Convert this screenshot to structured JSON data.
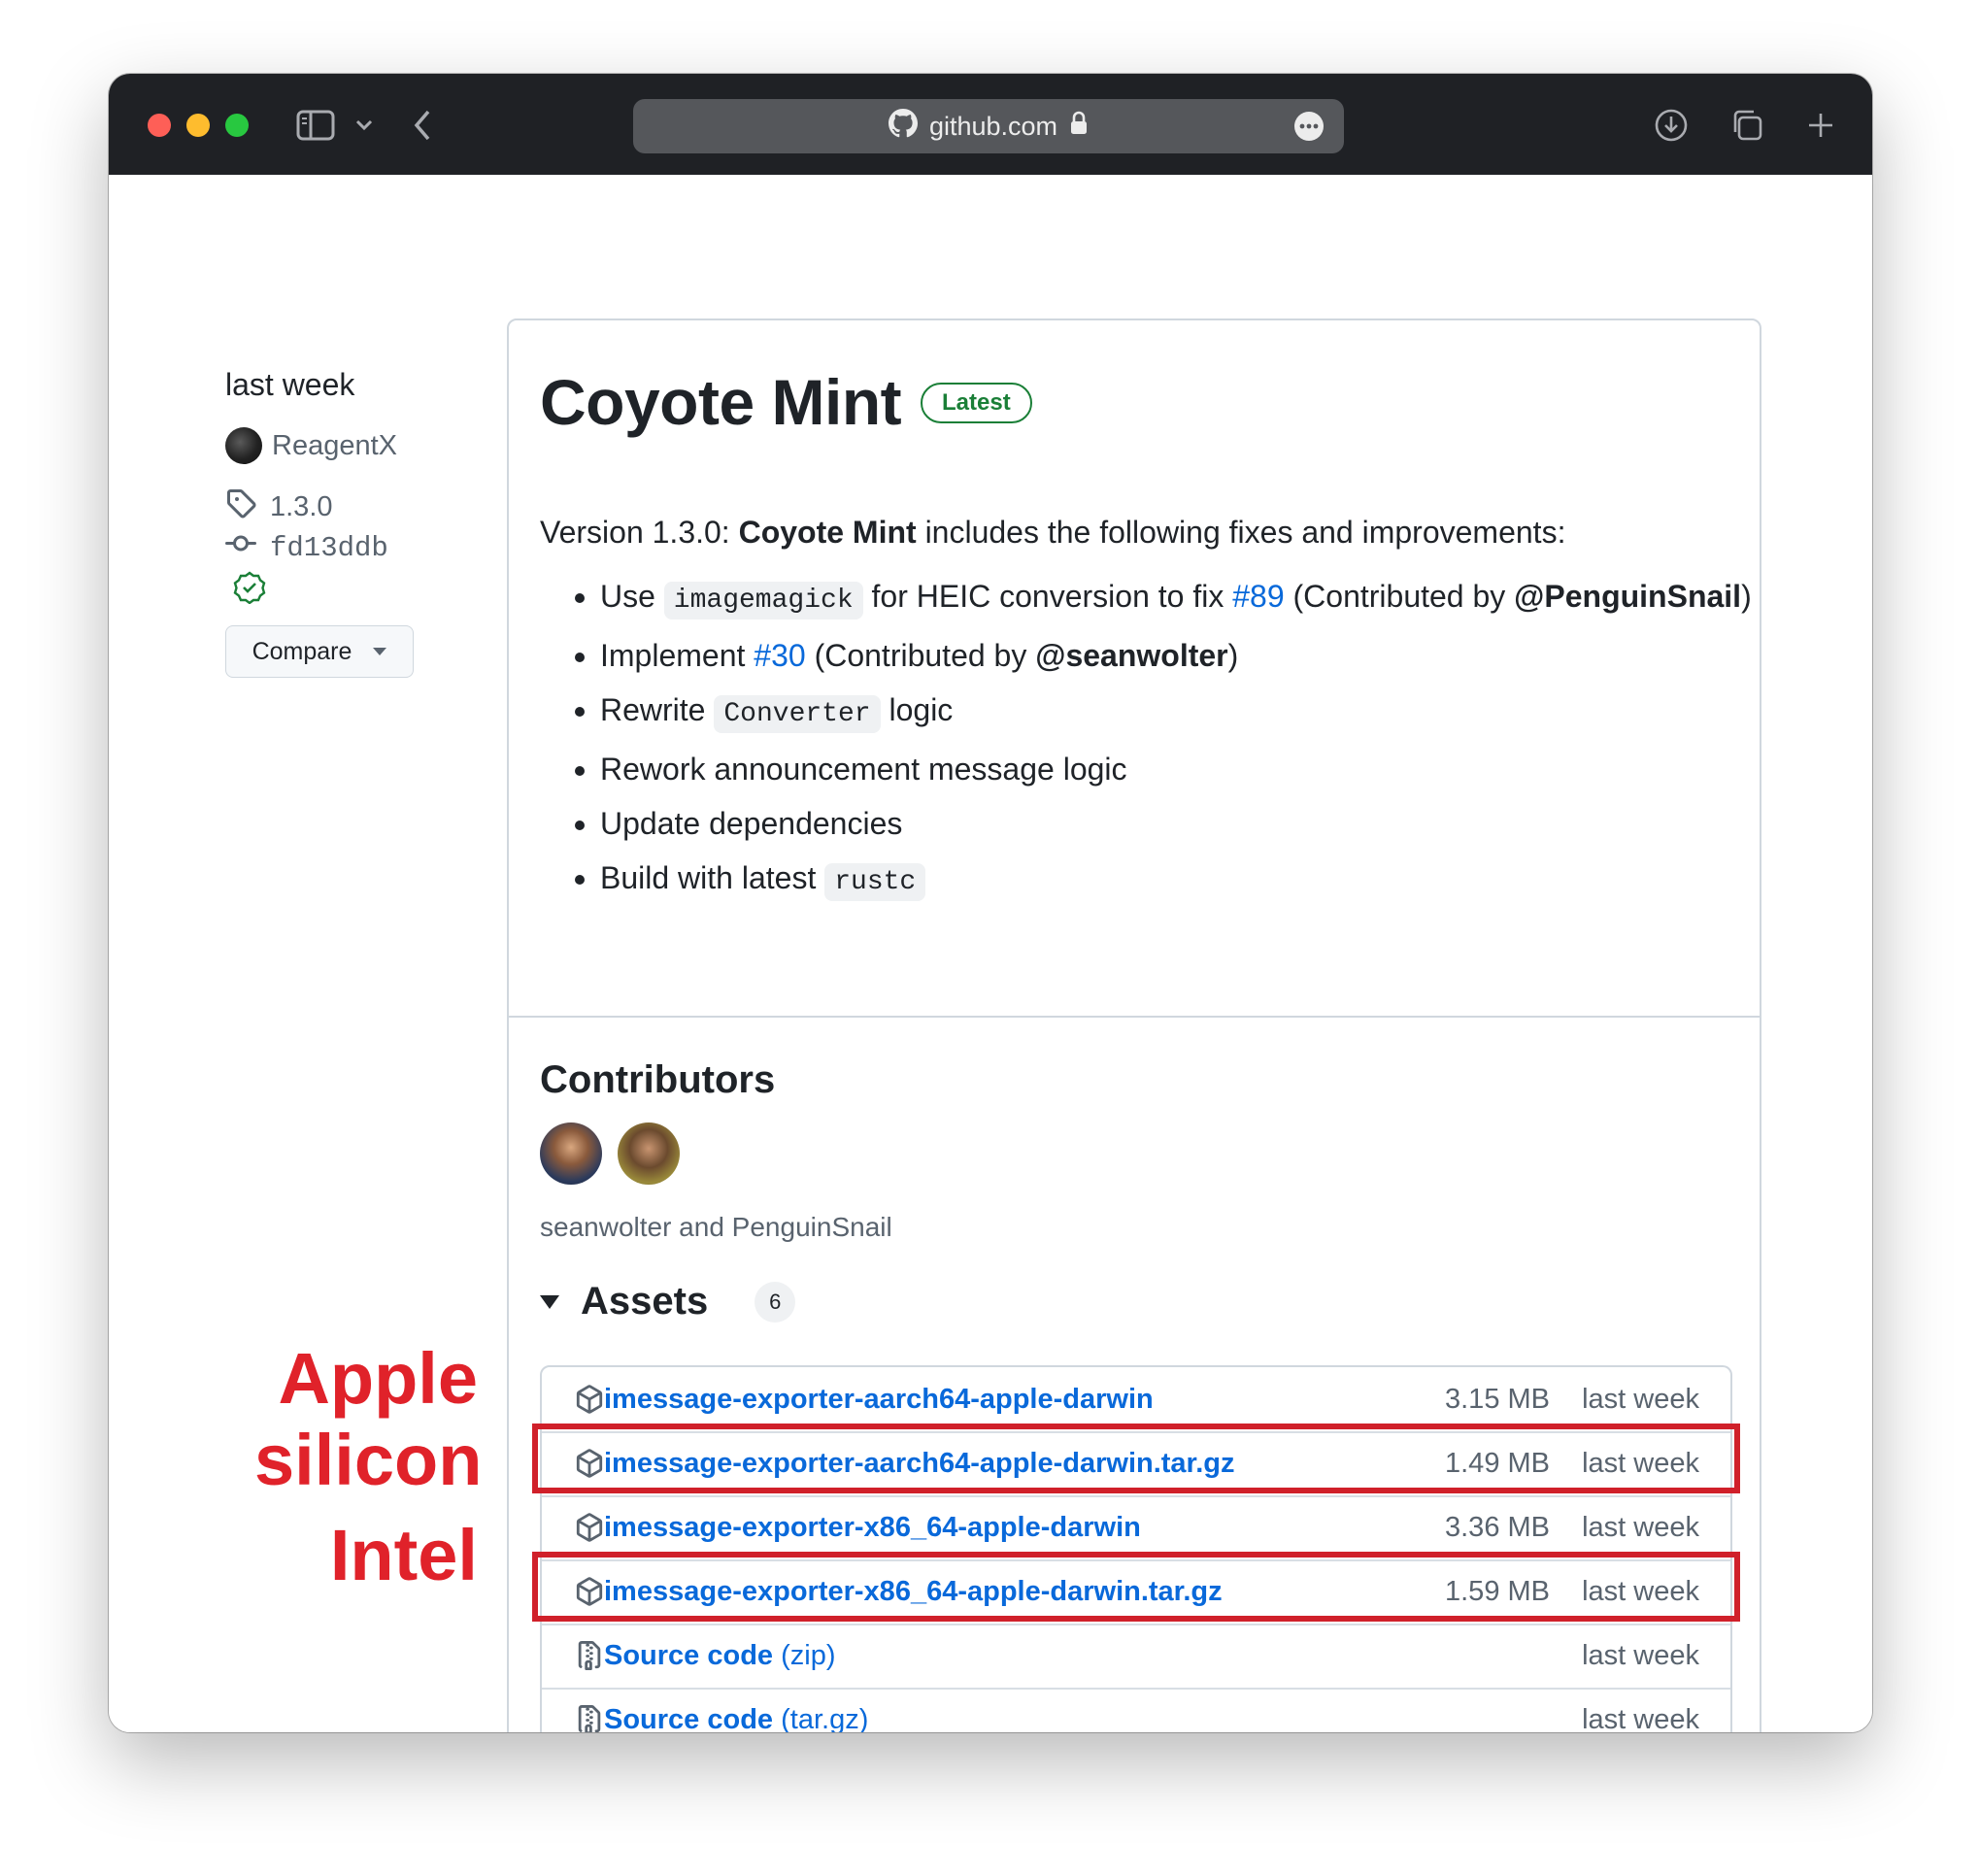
{
  "browser": {
    "address": "github.com",
    "colors": {
      "toolbar": "#1f2125",
      "address_bar": "#55575b"
    }
  },
  "sidebar": {
    "date": "last week",
    "author": "ReagentX",
    "tag": "1.3.0",
    "commit": "fd13ddb",
    "compare_label": "Compare"
  },
  "release": {
    "title": "Coyote Mint",
    "badge": "Latest",
    "intro_prefix": "Version 1.3.0: ",
    "intro_bold": "Coyote Mint",
    "intro_suffix": " includes the following fixes and improvements:",
    "notes": {
      "n1_a": "Use ",
      "n1_code": "imagemagick",
      "n1_b": " for HEIC conversion to fix ",
      "n1_link": "#89",
      "n1_c": " (Contributed by ",
      "n1_mention": "@PenguinSnail",
      "n1_d": ")",
      "n2_a": "Implement ",
      "n2_link": "#30",
      "n2_b": " (Contributed by ",
      "n2_mention": "@seanwolter",
      "n2_c": ")",
      "n3_a": "Rewrite ",
      "n3_code": "Converter",
      "n3_b": " logic",
      "n4": "Rework announcement message logic",
      "n5": "Update dependencies",
      "n6_a": "Build with latest ",
      "n6_code": "rustc"
    },
    "contributors_heading": "Contributors",
    "contributors_text": "seanwolter and PenguinSnail",
    "assets_heading": "Assets",
    "assets_count": "6",
    "assets": [
      {
        "name": "imessage-exporter-aarch64-apple-darwin",
        "ext": "",
        "size": "3.15 MB",
        "date": "last week"
      },
      {
        "name": "imessage-exporter-aarch64-apple-darwin.tar.gz",
        "ext": "",
        "size": "1.49 MB",
        "date": "last week"
      },
      {
        "name": "imessage-exporter-x86_64-apple-darwin",
        "ext": "",
        "size": "3.36 MB",
        "date": "last week"
      },
      {
        "name": "imessage-exporter-x86_64-apple-darwin.tar.gz",
        "ext": "",
        "size": "1.59 MB",
        "date": "last week"
      },
      {
        "name": "Source code",
        "ext": " (zip)",
        "size": "",
        "date": "last week"
      },
      {
        "name": "Source code",
        "ext": " (tar.gz)",
        "size": "",
        "date": "last week"
      }
    ]
  },
  "annotations": {
    "apple_line1": "Apple",
    "apple_line2": "silicon",
    "intel": "Intel",
    "color": "#e0222a"
  },
  "icons": [
    "sidebar-icon",
    "chevron-down-icon",
    "back-icon",
    "github-icon",
    "lock-icon",
    "more-icon",
    "download-icon",
    "tabs-icon",
    "plus-icon",
    "tag-icon",
    "commit-icon",
    "verified-icon",
    "package-icon",
    "file-zip-icon"
  ]
}
